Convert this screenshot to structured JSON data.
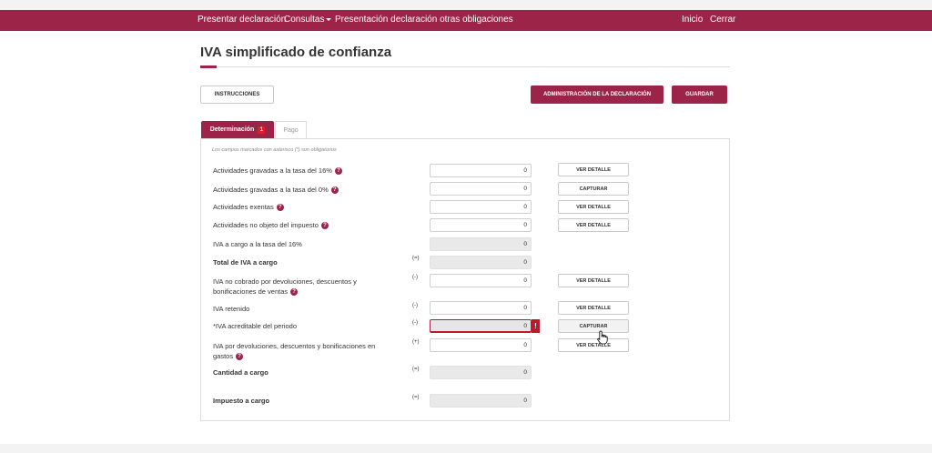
{
  "nav": {
    "presentar": "Presentar declaración",
    "consultas": "Consultas",
    "otras": "Presentación declaración otras obligaciones",
    "inicio": "Inicio",
    "cerrar": "Cerrar"
  },
  "page": {
    "title": "IVA simplificado de confianza"
  },
  "buttons": {
    "instrucciones": "INSTRUCCIONES",
    "administracion": "ADMINISTRACIÓN DE LA DECLARACIÓN",
    "guardar": "GUARDAR"
  },
  "tabs": {
    "determinacion": "Determinación",
    "determinacion_badge": "1",
    "pago": "Pago"
  },
  "form": {
    "note": "Los campos marcados con asterisco (*) son obligatorios",
    "rows": [
      {
        "label": "Actividades gravadas a la tasa del 16%",
        "value": "0",
        "button": "VER DETALLE"
      },
      {
        "label": "Actividades gravadas a la tasa del 0%",
        "value": "0",
        "button": "CAPTURAR"
      },
      {
        "label": "Actividades exentas",
        "value": "0",
        "button": "VER DETALLE"
      },
      {
        "label": "Actividades no objeto del impuesto",
        "value": "0",
        "button": "VER DETALLE"
      },
      {
        "label": "IVA a cargo a la tasa del 16%",
        "value": "0"
      },
      {
        "label": "Total de IVA a cargo",
        "operator": "(=)",
        "value": "0"
      },
      {
        "label": "IVA no cobrado por devoluciones, descuentos y bonificaciones de ventas",
        "operator": "(-)",
        "value": "0",
        "button": "VER DETALLE"
      },
      {
        "label": "IVA retenido",
        "operator": "(-)",
        "value": "0",
        "button": "VER DETALLE"
      },
      {
        "label": "*IVA acreditable del periodo",
        "operator": "(-)",
        "value": "0",
        "button": "CAPTURAR",
        "error_mark": "!"
      },
      {
        "label": "IVA por devoluciones, descuentos y bonificaciones en gastos",
        "operator": "(+)",
        "value": "0",
        "button": "VER DETALLE"
      },
      {
        "label": "Cantidad a cargo",
        "operator": "(=)",
        "value": "0"
      },
      {
        "label": "Impuesto a cargo",
        "operator": "(=)",
        "value": "0"
      }
    ],
    "help_glyph": "?"
  },
  "colors": {
    "brand": "#9d2449",
    "error": "#c0182a"
  }
}
